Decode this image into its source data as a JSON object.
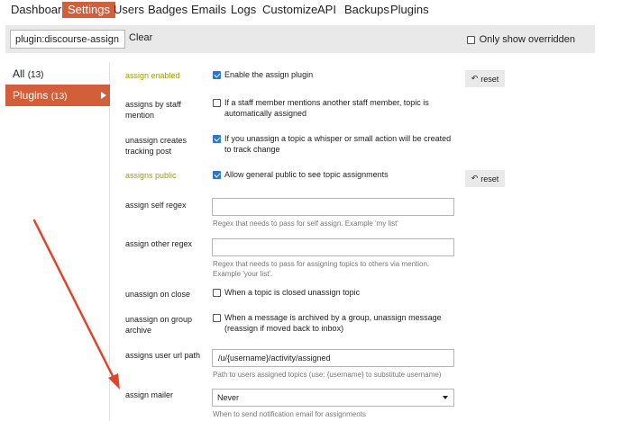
{
  "nav": {
    "items": [
      {
        "label": "Dashboard",
        "active": false
      },
      {
        "label": "Settings",
        "active": true
      },
      {
        "label": "Users",
        "active": false
      },
      {
        "label": "Badges",
        "active": false
      },
      {
        "label": "Emails",
        "active": false
      },
      {
        "label": "Logs",
        "active": false
      },
      {
        "label": "Customize",
        "active": false
      },
      {
        "label": "API",
        "active": false
      },
      {
        "label": "Backups",
        "active": false
      },
      {
        "label": "Plugins",
        "active": false
      }
    ]
  },
  "filter": {
    "value": "plugin:discourse-assign",
    "clear_label": "Clear",
    "override_label": "Only show overridden",
    "override_checked": false
  },
  "sidebar": {
    "items": [
      {
        "label": "All",
        "count": "(13)",
        "active": false
      },
      {
        "label": "Plugins",
        "count": "(13)",
        "active": true
      }
    ]
  },
  "reset_label": "reset",
  "settings": [
    {
      "name": "assign enabled",
      "overridden": true,
      "type": "checkbox",
      "checked": true,
      "text": "Enable the assign plugin",
      "reset": true
    },
    {
      "name": "assigns by staff mention",
      "overridden": false,
      "type": "checkbox",
      "checked": false,
      "text": "If a staff member mentions another staff member, topic is automatically assigned",
      "reset": false
    },
    {
      "name": "unassign creates tracking post",
      "overridden": false,
      "type": "checkbox",
      "checked": true,
      "text": "If you unassign a topic a whisper or small action will be created to track change",
      "reset": false
    },
    {
      "name": "assigns public",
      "overridden": true,
      "type": "checkbox",
      "checked": true,
      "text": "Allow general public to see topic assignments",
      "reset": true
    },
    {
      "name": "assign self regex",
      "overridden": false,
      "type": "text",
      "value": "",
      "description": "Regex that needs to pass for self assign. Example 'my list'"
    },
    {
      "name": "assign other regex",
      "overridden": false,
      "type": "text",
      "value": "",
      "description": "Regex that needs to pass for assigning topics to others via mention. Example 'your list'."
    },
    {
      "name": "unassign on close",
      "overridden": false,
      "type": "checkbox",
      "checked": false,
      "text": "When a topic is closed unassign topic",
      "reset": false
    },
    {
      "name": "unassign on group archive",
      "overridden": false,
      "type": "checkbox",
      "checked": false,
      "text": "When a message is archived by a group, unassign message (reassign if moved back to inbox)",
      "reset": false
    },
    {
      "name": "assigns user url path",
      "overridden": false,
      "type": "text",
      "value": "/u/{username}/activity/assigned",
      "description": "Path to users assigned topics (use: {username} to substitute username)"
    },
    {
      "name": "assign mailer",
      "overridden": false,
      "type": "select",
      "value": "Never",
      "description": "When to send notification email for assignments"
    }
  ],
  "colors": {
    "accent": "#d35f3a",
    "overridden_label": "#9e9e00",
    "checkbox_checked": "#2a76d2",
    "annotation_arrow": "#e0452b"
  },
  "icons": {
    "reset": "undo-icon",
    "sidebar_active": "caret-right-icon",
    "select": "chevron-down-icon"
  }
}
